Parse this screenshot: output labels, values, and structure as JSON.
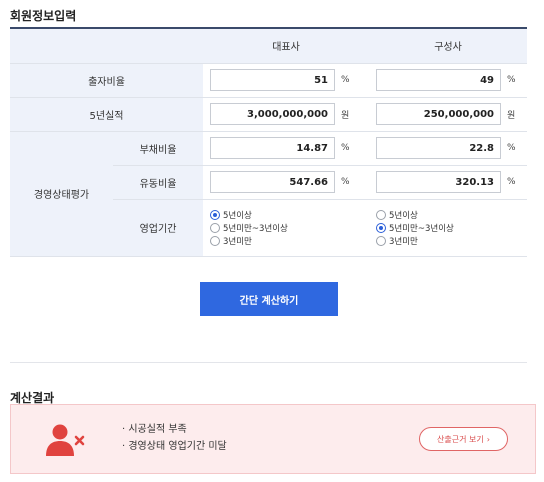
{
  "sections": {
    "member_input": "회원정보입력",
    "result": "계산결과"
  },
  "table": {
    "col_representative": "대표사",
    "col_member": "구성사",
    "equity_ratio": {
      "label": "출자비율",
      "rep_value": "51",
      "member_value": "49",
      "unit": "%"
    },
    "five_year_record": {
      "label": "5년실적",
      "rep_value": "3,000,000,000",
      "member_value": "250,000,000",
      "unit": "원"
    },
    "eval_group_label": "경영상태평가",
    "debt_ratio": {
      "label": "부채비율",
      "rep_value": "14.87",
      "member_value": "22.8",
      "unit": "%"
    },
    "liquidity_ratio": {
      "label": "유동비율",
      "rep_value": "547.66",
      "member_value": "320.13",
      "unit": "%"
    },
    "operating_period": {
      "label": "영업기간",
      "options": [
        "5년이상",
        "5년미만~3년이상",
        "3년미만"
      ],
      "rep_selected": 0,
      "member_selected": 1
    }
  },
  "calc_button": "간단 계산하기",
  "result": {
    "messages": [
      "시공실적 부족",
      "경영상태 영업기간 미달"
    ],
    "reason_button": "산출근거 보기",
    "reason_arrow": "›",
    "accent_color": "#d94b4b"
  }
}
